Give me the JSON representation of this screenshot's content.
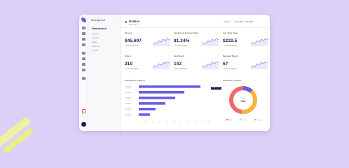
{
  "sidebar": {
    "workspace": "Development",
    "title": "Dashboard",
    "items": [
      {
        "label": "Overview",
        "active": false
      },
      {
        "label": "Analytics",
        "active": false
      },
      {
        "label": "Orders",
        "active": true
      },
      {
        "label": "Customers",
        "active": false
      },
      {
        "label": "Products",
        "active": false
      }
    ]
  },
  "header": {
    "title": "Orders",
    "subtitle": "Dashboard",
    "range_label": "Duration",
    "dates": "5 Jan 2023 - 5 Jan 2023"
  },
  "metrics": [
    {
      "label": "Revenue",
      "value": "$45,697",
      "change": "+ 4.8% ",
      "change_dir": "up",
      "suffix": "vs last year"
    },
    {
      "label": "New Buyers Revenue Share",
      "value": "81.24%",
      "change": "+ 4.8% ",
      "change_dir": "up",
      "suffix": "vs last year"
    },
    {
      "label": "Avg. Order Value",
      "value": "$232.5",
      "change": "+ 4.8% ",
      "change_dir": "up",
      "suffix": "vs last year"
    },
    {
      "label": "Orders",
      "value": "210",
      "change": "+ 4.8% ",
      "change_dir": "up",
      "suffix": "vs last year"
    },
    {
      "label": "New Buyers",
      "value": "143",
      "change": "- 4.8% ",
      "change_dir": "down",
      "suffix": "vs last year"
    },
    {
      "label": "Repeated Buyers",
      "value": "67",
      "change": "+ 4.8% ",
      "change_dir": "up",
      "suffix": "vs last year"
    }
  ],
  "category_panel": {
    "title": "Purchases by Category",
    "categories": [
      "Category",
      "Category",
      "Category",
      "Category",
      "Category",
      "Category"
    ],
    "values": [
      88,
      65,
      52,
      38,
      24,
      16
    ],
    "xmax": 100,
    "ticks": [
      "0",
      "10",
      "20",
      "30",
      "40",
      "50",
      "60",
      "70",
      "80",
      "90",
      "100"
    ],
    "bar_color": "#6a5ce8"
  },
  "device_panel": {
    "title": "Purchases by Device",
    "center_label": "Total",
    "center_value": "210",
    "tooltip": "Mobile 12%",
    "segments": [
      {
        "name": "Mobile",
        "value": 12,
        "color": "#6a5ce8"
      },
      {
        "name": "Tablet",
        "value": 40,
        "color": "#f5b63a"
      },
      {
        "name": "Desktop",
        "value": 48,
        "color": "#ef6b6b"
      }
    ]
  }
}
